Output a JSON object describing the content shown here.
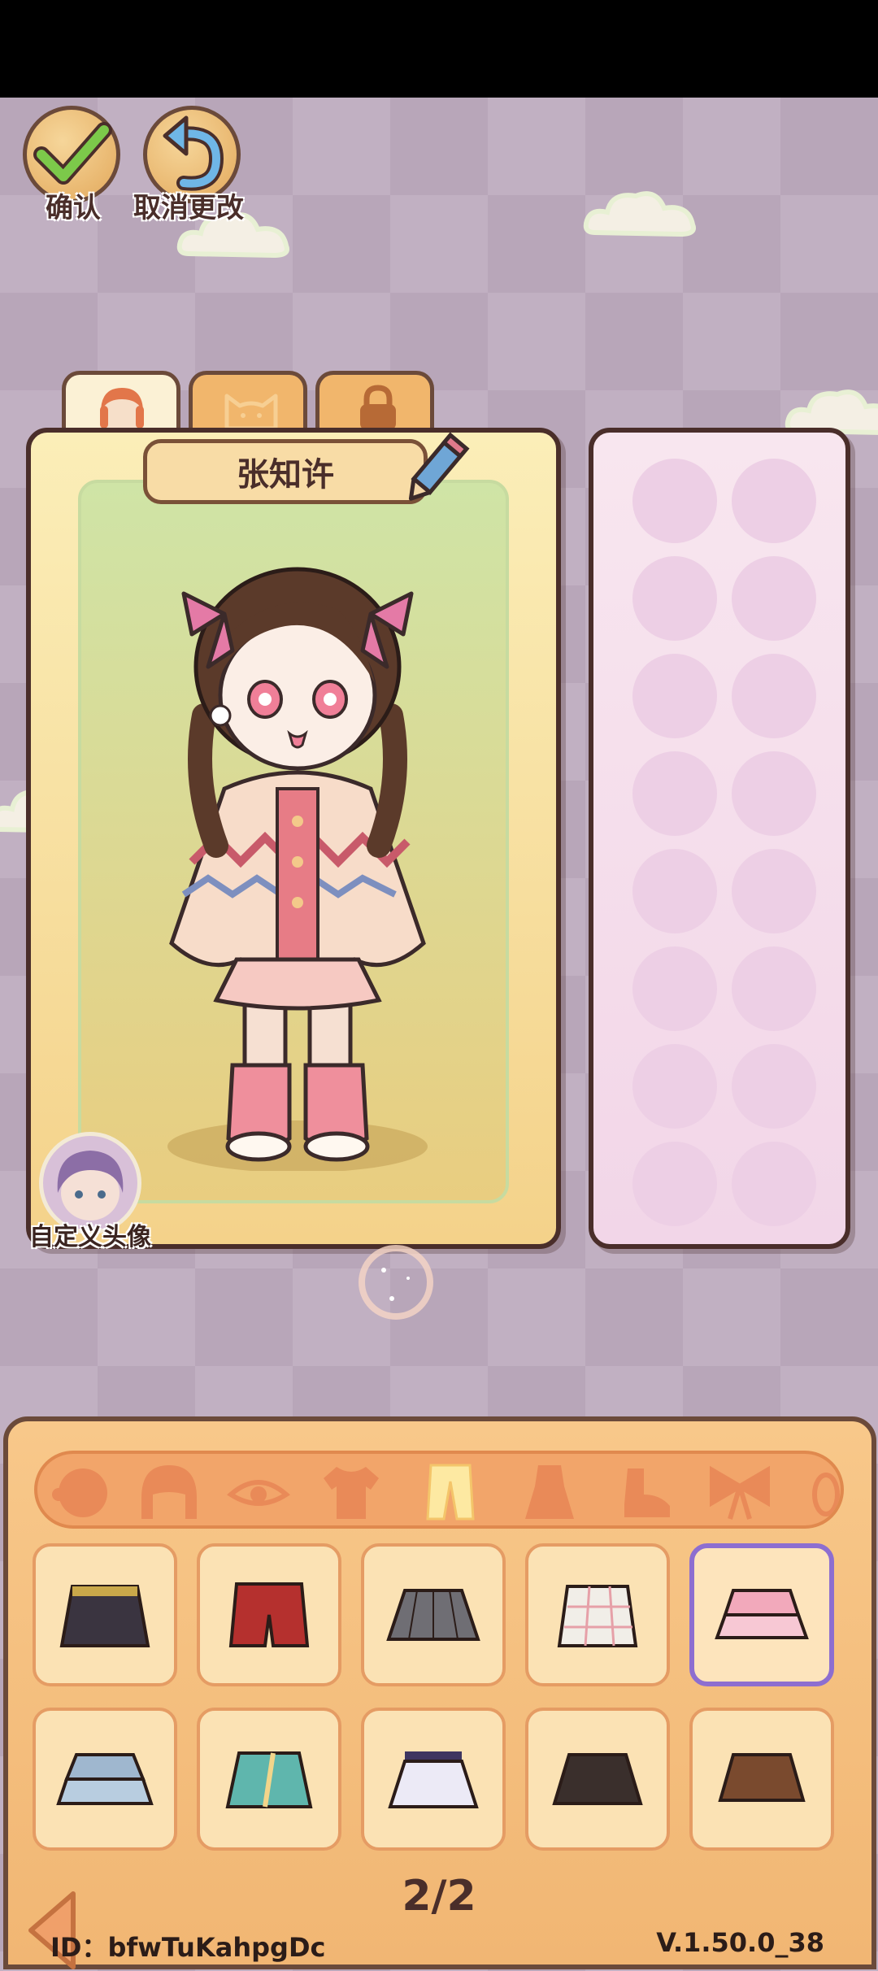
{
  "header": {
    "confirm_label": "确认",
    "cancel_label": "取消更改"
  },
  "tabs": [
    {
      "icon": "face-icon",
      "active": true
    },
    {
      "icon": "cat-icon",
      "active": false
    },
    {
      "icon": "lock-icon",
      "active": false
    }
  ],
  "character": {
    "name": "张知许",
    "custom_avatar_label": "自定义头像"
  },
  "categories": [
    "face-shape-icon",
    "hair-icon",
    "eye-icon",
    "top-icon",
    "bottom-icon",
    "dress-icon",
    "shoes-icon",
    "bow-icon",
    "accessory-icon"
  ],
  "selected_category": "bottom-icon",
  "items": [
    {
      "name": "black-belted-skirt",
      "color": "#3a3440"
    },
    {
      "name": "red-shorts",
      "color": "#b5302e"
    },
    {
      "name": "grey-pleated-skirt",
      "color": "#6f6e74"
    },
    {
      "name": "white-plaid-skirt",
      "color": "#f1eee8"
    },
    {
      "name": "pink-ruffle-skirt",
      "color": "#f2a9bb",
      "selected": true
    },
    {
      "name": "blue-ruffle-skirt",
      "color": "#9fb7cf"
    },
    {
      "name": "teal-wrap-skirt",
      "color": "#5fb6ad"
    },
    {
      "name": "white-pleated-skirt",
      "color": "#eceaf6"
    },
    {
      "name": "black-pleated-skirt",
      "color": "#3a2f2c"
    },
    {
      "name": "brown-pleated-skirt",
      "color": "#7a4a2e"
    }
  ],
  "pagination": {
    "label": "2/2"
  },
  "footer": {
    "id_label": "ID：bfwTuKahpgDc",
    "version": "V.1.50.0_38"
  }
}
